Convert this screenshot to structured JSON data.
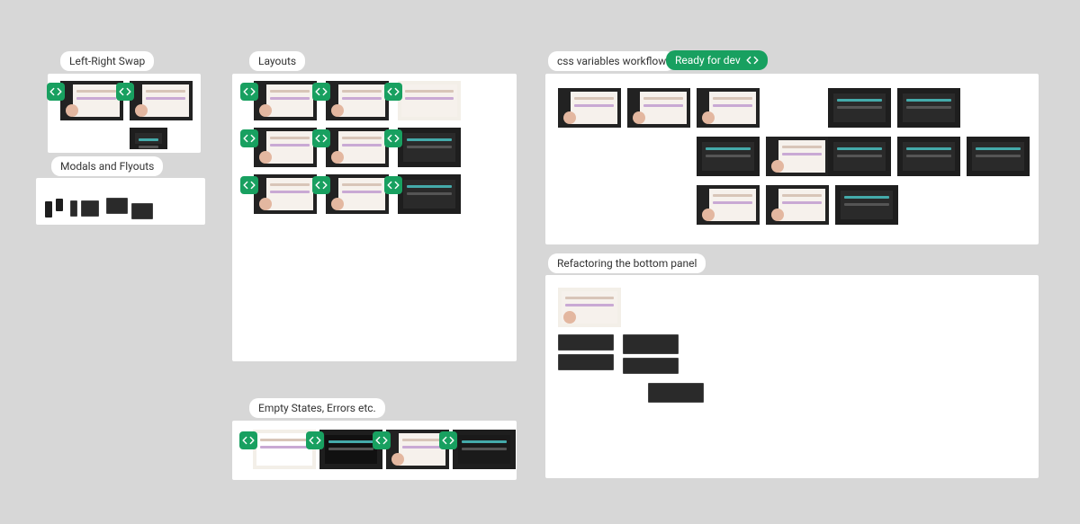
{
  "sections": {
    "left_right_swap": {
      "label": "Left-Right Swap"
    },
    "modals_flyouts": {
      "label": "Modals and Flyouts"
    },
    "layouts": {
      "label": "Layouts"
    },
    "empty_states": {
      "label": "Empty States, Errors etc."
    },
    "css_vars": {
      "label": "css variables workflow"
    },
    "refactor_bottom": {
      "label": "Refactoring the bottom panel"
    }
  },
  "status": {
    "ready_for_dev": "Ready for dev"
  }
}
